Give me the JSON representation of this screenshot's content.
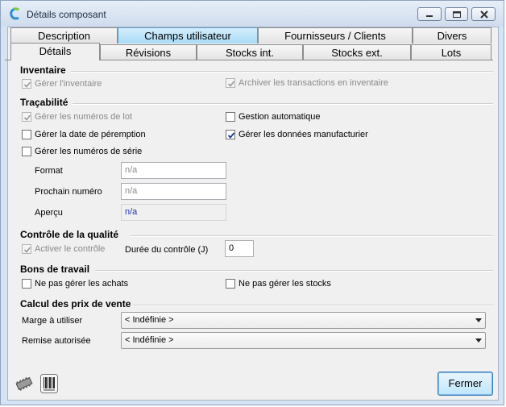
{
  "window": {
    "title": "Détails composant"
  },
  "tabs_row1": [
    "Description",
    "Champs utilisateur",
    "Fournisseurs / Clients",
    "Divers"
  ],
  "tabs_row2": [
    "Détails",
    "Révisions",
    "Stocks int.",
    "Stocks ext.",
    "Lots"
  ],
  "inventaire": {
    "title": "Inventaire",
    "gerer_inventaire": "Gérer l'inventaire",
    "archiver": "Archiver les transactions en inventaire"
  },
  "tracabilite": {
    "title": "Traçabilité",
    "numeros_lot": "Gérer les numéros de lot",
    "gestion_auto": "Gestion automatique",
    "date_peremption": "Gérer la date de péremption",
    "donnees_manufacturier": "Gérer les données manufacturier",
    "numeros_serie": "Gérer les numéros de série",
    "format_label": "Format",
    "format_value": "n/a",
    "prochain_label": "Prochain numéro",
    "prochain_value": "n/a",
    "apercu_label": "Aperçu",
    "apercu_value": "n/a"
  },
  "qualite": {
    "title": "Contrôle de la qualité",
    "activer": "Activer le contrôle",
    "duree_label": "Durée du contrôle (J)",
    "duree_value": "0"
  },
  "bons": {
    "title": "Bons de travail",
    "achats": "Ne pas gérer les achats",
    "stocks": "Ne pas gérer les stocks"
  },
  "prix": {
    "title": "Calcul des prix de vente",
    "marge_label": "Marge à utiliser",
    "marge_value": "< Indéfinie >",
    "remise_label": "Remise autorisée",
    "remise_value": "< Indéfinie >"
  },
  "footer": {
    "close_label": "Fermer"
  },
  "colors": {
    "accent": "#3c7fb1",
    "tab_highlight": "#a9dbf6"
  }
}
